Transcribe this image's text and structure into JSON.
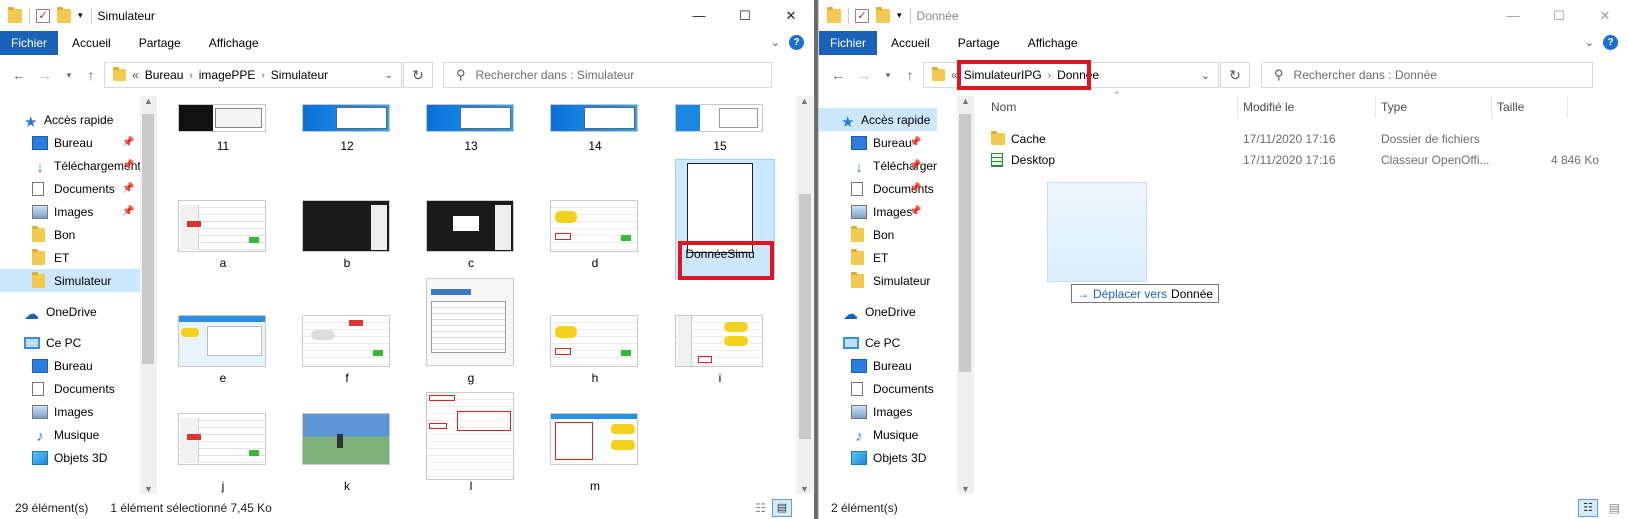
{
  "left": {
    "title": "Simulateur",
    "ribbon_tabs": [
      "Fichier",
      "Accueil",
      "Partage",
      "Affichage"
    ],
    "breadcrumb": [
      "Bureau",
      "imagePPE",
      "Simulateur"
    ],
    "search_placeholder": "Rechercher dans : Simulateur",
    "nav": {
      "quick_access": "Accès rapide",
      "items": [
        "Bureau",
        "Téléchargements",
        "Documents",
        "Images",
        "Bon",
        "ET",
        "Simulateur"
      ],
      "onedrive": "OneDrive",
      "this_pc": "Ce PC",
      "pc_items": [
        "Bureau",
        "Documents",
        "Images",
        "Musique",
        "Objets 3D"
      ]
    },
    "files": [
      {
        "name": "11",
        "style": "dark-win"
      },
      {
        "name": "12",
        "style": "blue-win"
      },
      {
        "name": "13",
        "style": "blue-win"
      },
      {
        "name": "14",
        "style": "blue-win"
      },
      {
        "name": "15",
        "style": "blue-win2"
      },
      {
        "name": "a",
        "style": "form"
      },
      {
        "name": "b",
        "style": "black"
      },
      {
        "name": "c",
        "style": "black-dialog"
      },
      {
        "name": "d",
        "style": "car-form"
      },
      {
        "name": "DonnéeSimu",
        "style": "blank"
      },
      {
        "name": "e",
        "style": "car-blue"
      },
      {
        "name": "f",
        "style": "car-form2"
      },
      {
        "name": "g",
        "style": "dialog"
      },
      {
        "name": "h",
        "style": "car-form"
      },
      {
        "name": "i",
        "style": "car-form3"
      },
      {
        "name": "j",
        "style": "form"
      },
      {
        "name": "k",
        "style": "scene"
      },
      {
        "name": "l",
        "style": "settings"
      },
      {
        "name": "m",
        "style": "multi"
      }
    ],
    "status_count": "29 élément(s)",
    "status_selected": "1 élément sélectionné  7,45 Ko"
  },
  "right": {
    "title": "Donnée",
    "ribbon_tabs": [
      "Fichier",
      "Accueil",
      "Partage",
      "Affichage"
    ],
    "breadcrumb": [
      "SimulateurIPG",
      "Donnée"
    ],
    "search_placeholder": "Rechercher dans : Donnée",
    "columns": [
      "Nom",
      "Modifié le",
      "Type",
      "Taille"
    ],
    "rows": [
      {
        "name": "Cache",
        "date": "17/11/2020 17:16",
        "type": "Dossier de fichiers",
        "size": "",
        "icon": "folder"
      },
      {
        "name": "Desktop",
        "date": "17/11/2020 17:16",
        "type": "Classeur OpenOffi...",
        "size": "4 846 Ko",
        "icon": "spreadsheet"
      }
    ],
    "nav": {
      "quick_access": "Accès rapide",
      "items": [
        "Bureau",
        "Téléchargements",
        "Documents",
        "Images",
        "Bon",
        "ET",
        "Simulateur"
      ],
      "onedrive": "OneDrive",
      "this_pc": "Ce PC",
      "pc_items": [
        "Bureau",
        "Documents",
        "Images",
        "Musique",
        "Objets 3D"
      ]
    },
    "drag_tooltip_prefix": "Déplacer vers",
    "drag_tooltip_target": "Donnée",
    "status_count": "2 élément(s)"
  },
  "colors": {
    "accent": "#1a62b8",
    "highlight_red": "#e0141e",
    "selection": "#cce8ff",
    "folder": "#f4c94f"
  }
}
